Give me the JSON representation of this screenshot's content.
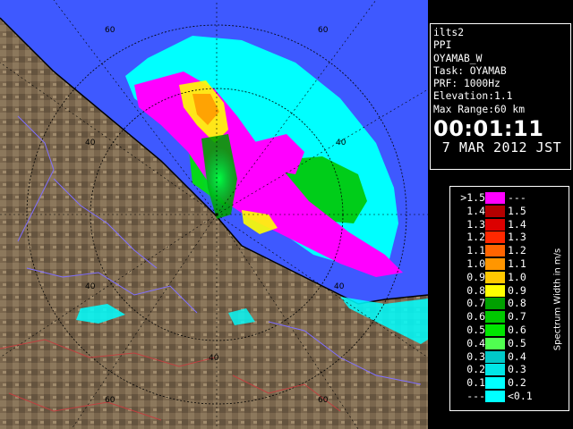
{
  "info": {
    "lines": [
      "ilts2",
      "PPI",
      "OYAMAB_W",
      "Task: OYAMAB",
      "PRF: 1000Hz",
      "Elevation:1.1",
      "Max Range:60 km"
    ],
    "time": "00:01:11",
    "date": "7 MAR 2012 JST"
  },
  "legend": {
    "title": "Spectrum Width in m/s",
    "rows": [
      {
        "left": ">1.5",
        "right": "---",
        "color": "#ff00ff"
      },
      {
        "left": "1.4",
        "right": "1.5",
        "color": "#b40000"
      },
      {
        "left": "1.3",
        "right": "1.4",
        "color": "#dc0000"
      },
      {
        "left": "1.2",
        "right": "1.3",
        "color": "#ff2800"
      },
      {
        "left": "1.1",
        "right": "1.2",
        "color": "#ff6400"
      },
      {
        "left": "1.0",
        "right": "1.1",
        "color": "#ff9600"
      },
      {
        "left": "0.9",
        "right": "1.0",
        "color": "#ffc800"
      },
      {
        "left": "0.8",
        "right": "0.9",
        "color": "#ffff00"
      },
      {
        "left": "0.7",
        "right": "0.8",
        "color": "#00a000"
      },
      {
        "left": "0.6",
        "right": "0.7",
        "color": "#00c800"
      },
      {
        "left": "0.5",
        "right": "0.6",
        "color": "#00e600"
      },
      {
        "left": "0.4",
        "right": "0.5",
        "color": "#50ff50"
      },
      {
        "left": "0.3",
        "right": "0.4",
        "color": "#00c8c8"
      },
      {
        "left": "0.2",
        "right": "0.3",
        "color": "#00e6e6"
      },
      {
        "left": "0.1",
        "right": "0.2",
        "color": "#00ffff"
      },
      {
        "left": "---",
        "right": "<0.1",
        "color": "#00ffff"
      }
    ]
  },
  "map": {
    "range_labels": [
      "60",
      "60",
      "40",
      "40",
      "40",
      "40",
      "60",
      "60"
    ],
    "colors": {
      "sea": "#3e59ff",
      "land": "#7d6a52",
      "no_echo": "#000000"
    }
  }
}
